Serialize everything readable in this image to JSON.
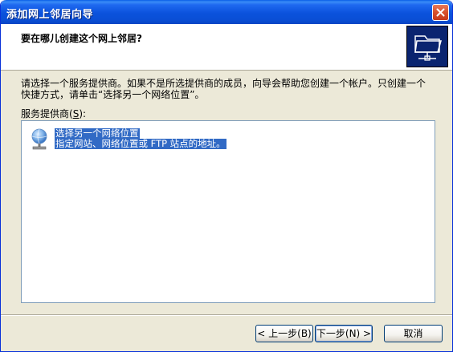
{
  "window": {
    "title": "添加网上邻居向导"
  },
  "header": {
    "title": "要在哪儿创建这个网上邻居?"
  },
  "content": {
    "description_line1": "请选择一个服务提供商。如果不是所选提供商的成员，向导会帮助您创建一个帐户。只创建一个",
    "description_line2": "快捷方式，请单击“选择另一个网络位置”。",
    "list_label": "服务提供商(",
    "list_label_key": "S",
    "list_label_end": "):",
    "providers": [
      {
        "name": "选择另一个网络位置",
        "detail": "指定网站、网络位置或 FTP 站点的地址。",
        "icon": "network-place-icon"
      }
    ]
  },
  "buttons": {
    "back": "< 上一步(B)",
    "next": "下一步(N) >",
    "cancel": "取消"
  },
  "colors": {
    "titlebar": "#0a52dc",
    "selection": "#316ac5",
    "window_bg": "#ece9d8"
  }
}
